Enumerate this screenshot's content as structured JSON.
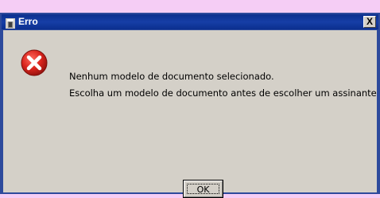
{
  "dialog": {
    "title": "Erro",
    "close_label": "X",
    "icon": "error-icon",
    "messages": [
      "Nenhum modelo de documento selecionado.",
      "Escolha um modelo de documento antes de escolher um assinante"
    ],
    "ok_label": "OK"
  },
  "colors": {
    "background": "#f5cdf5",
    "titlebar": "#0b2f8e",
    "client": "#d4d0c8",
    "error_red": "#d8241c"
  }
}
